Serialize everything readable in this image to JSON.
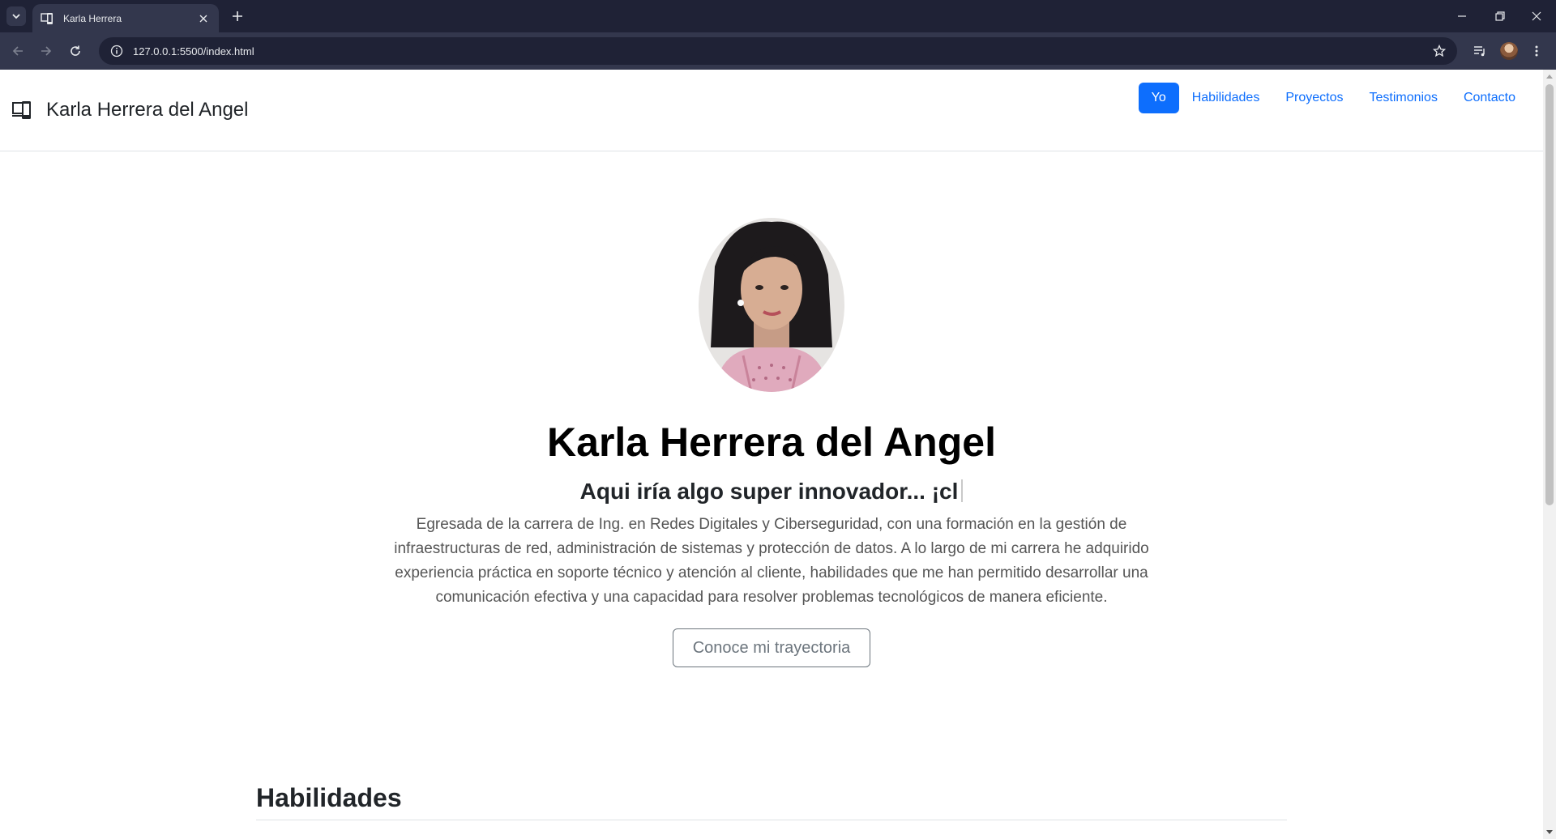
{
  "browser": {
    "tab_title": "Karla Herrera",
    "url": "127.0.0.1:5500/index.html"
  },
  "site": {
    "brand": "Karla Herrera del Angel",
    "nav": [
      {
        "label": "Yo",
        "active": true
      },
      {
        "label": "Habilidades",
        "active": false
      },
      {
        "label": "Proyectos",
        "active": false
      },
      {
        "label": "Testimonios",
        "active": false
      },
      {
        "label": "Contacto",
        "active": false
      }
    ],
    "accent_color": "#0d6efd"
  },
  "hero": {
    "name": "Karla Herrera del Angel",
    "tagline": "Aqui iría algo super innovador... ¡cl",
    "description": "Egresada de la carrera de Ing. en Redes Digitales y Ciberseguridad, con una formación en la gestión de infraestructuras de red, administración de sistemas y protección de datos. A lo largo de mi carrera he adquirido experiencia práctica en soporte técnico y atención al cliente, habilidades que me han permitido desarrollar una comunicación efectiva y una capacidad para resolver problemas tecnológicos de manera eficiente.",
    "button_label": "Conoce mi trayectoria",
    "photo_icon": "profile-photo"
  },
  "sections": {
    "skills_title": "Habilidades"
  }
}
